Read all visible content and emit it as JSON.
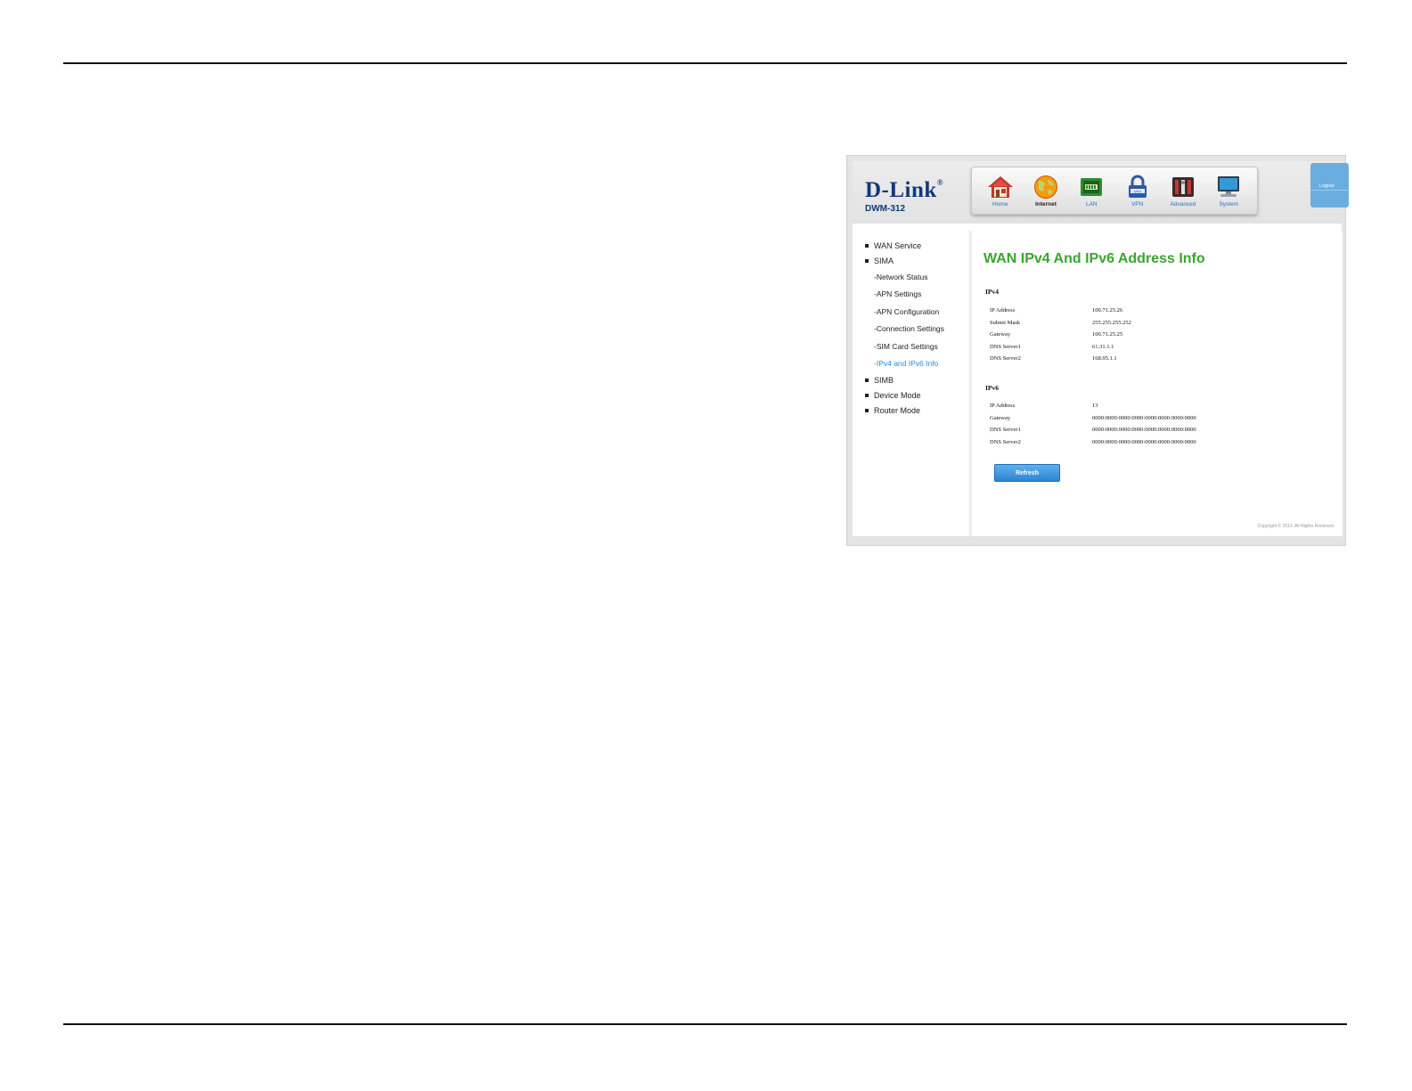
{
  "brand": {
    "logo_text": "D-Link",
    "logo_reg": "®",
    "model": "DWM-312"
  },
  "nav": {
    "items": [
      {
        "label": "Home",
        "icon": "home-icon"
      },
      {
        "label": "Internet",
        "icon": "globe-icon"
      },
      {
        "label": "LAN",
        "icon": "lan-icon"
      },
      {
        "label": "VPN",
        "icon": "lock-icon"
      },
      {
        "label": "Advanced",
        "icon": "tools-icon"
      },
      {
        "label": "System",
        "icon": "monitor-icon"
      }
    ],
    "active": "Internet"
  },
  "logout_label": "Logout",
  "sidebar": {
    "wan_service": "WAN Service",
    "sima": "SIMA",
    "sima_items": [
      "-Network Status",
      "-APN Settings",
      "-APN Configuration",
      "-Connection Settings",
      "-SIM Card Settings",
      "-IPv4 and IPv6 Info"
    ],
    "simb": "SIMB",
    "device_mode": "Device Mode",
    "router_mode": "Router Mode"
  },
  "content": {
    "title": "WAN IPv4 And IPv6 Address Info",
    "ipv4": {
      "heading": "IPv4",
      "rows": [
        {
          "label": "IP Address",
          "value": "100.71.25.26"
        },
        {
          "label": "Subnet Mask",
          "value": "255.255.255.252"
        },
        {
          "label": "Gateway",
          "value": "100.71.25.25"
        },
        {
          "label": "DNS Server1",
          "value": "61.31.1.1"
        },
        {
          "label": "DNS Server2",
          "value": "168.95.1.1"
        }
      ]
    },
    "ipv6": {
      "heading": "IPv6",
      "rows": [
        {
          "label": "IP Address",
          "value": "13"
        },
        {
          "label": "Gateway",
          "value": "0000:0000:0000:0000:0000:0000:0000:0000"
        },
        {
          "label": "DNS Server1",
          "value": "0000:0000:0000:0000:0000:0000:0000:0000"
        },
        {
          "label": "DNS Server2",
          "value": "0000:0000:0000:0000:0000:0000:0000:0000"
        }
      ]
    },
    "refresh_label": "Refresh",
    "copyright": "Copyright © 2012. All Rights Reserved"
  },
  "colors": {
    "title_green": "#3aa52e",
    "active_link_blue": "#2a8ae0",
    "logo_navy": "#0f3a78",
    "button_blue": "#2c85d3"
  }
}
